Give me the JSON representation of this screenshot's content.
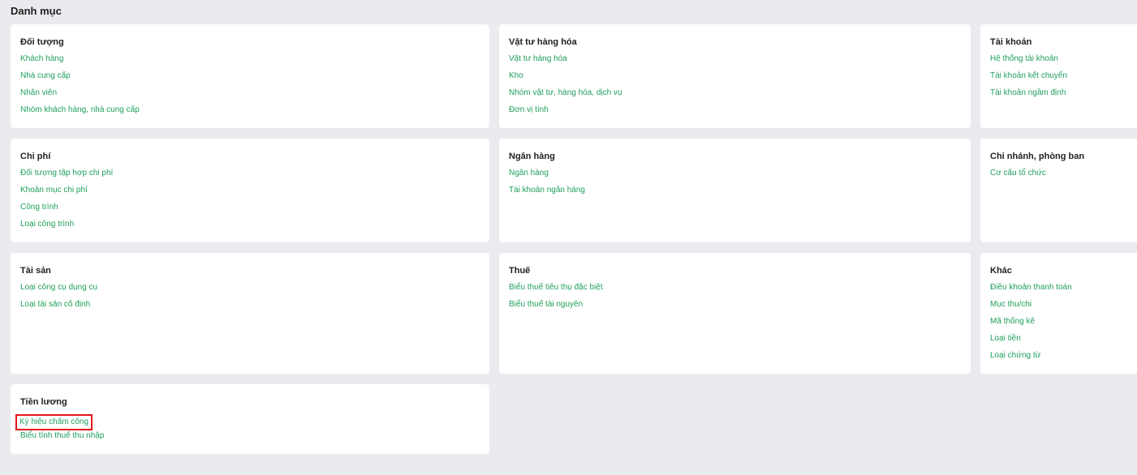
{
  "page": {
    "title": "Danh mục"
  },
  "colors": {
    "background": "#e9ebee",
    "card": "#ffffff",
    "link": "#1e9f5c",
    "highlight": "#e8141b"
  },
  "sections": {
    "doi_tuong": {
      "title": "Đối tượng",
      "items": [
        "Khách hàng",
        "Nhà cung cấp",
        "Nhân viên",
        "Nhóm khách hàng, nhà cung cấp"
      ]
    },
    "vat_tu": {
      "title": "Vật tư hàng hóa",
      "items": [
        "Vật tư hàng hóa",
        "Kho",
        "Nhóm vật tư, hàng hóa, dịch vụ",
        "Đơn vị tính"
      ]
    },
    "tai_khoan": {
      "title": "Tài khoản",
      "items": [
        "Hệ thống tài khoản",
        "Tài khoản kết chuyển",
        "Tài khoản ngầm định"
      ]
    },
    "chi_phi": {
      "title": "Chi phí",
      "items": [
        "Đối tượng tập hợp chi phí",
        "Khoản mục chi phí",
        "Công trình",
        "Loại công trình"
      ]
    },
    "ngan_hang": {
      "title": "Ngân hàng",
      "items": [
        "Ngân hàng",
        "Tài khoản ngân hàng"
      ]
    },
    "chi_nhanh": {
      "title": "Chi nhánh, phòng ban",
      "items": [
        "Cơ cấu tổ chức"
      ]
    },
    "tai_san": {
      "title": "Tài sản",
      "items": [
        "Loại công cụ dụng cụ",
        "Loại tài sản cố định"
      ]
    },
    "thue": {
      "title": "Thuế",
      "items": [
        "Biểu thuế tiêu thụ đặc biệt",
        "Biểu thuế tài nguyên"
      ]
    },
    "khac": {
      "title": "Khác",
      "items": [
        "Điều khoản thanh toán",
        "Mục thu/chi",
        "Mã thống kê",
        "Loại tiền",
        "Loại chứng từ"
      ]
    },
    "tien_luong": {
      "title": "Tiền lương",
      "items": [
        "Ký hiệu chấm công",
        "Biểu tính thuế thu nhập"
      ]
    }
  }
}
